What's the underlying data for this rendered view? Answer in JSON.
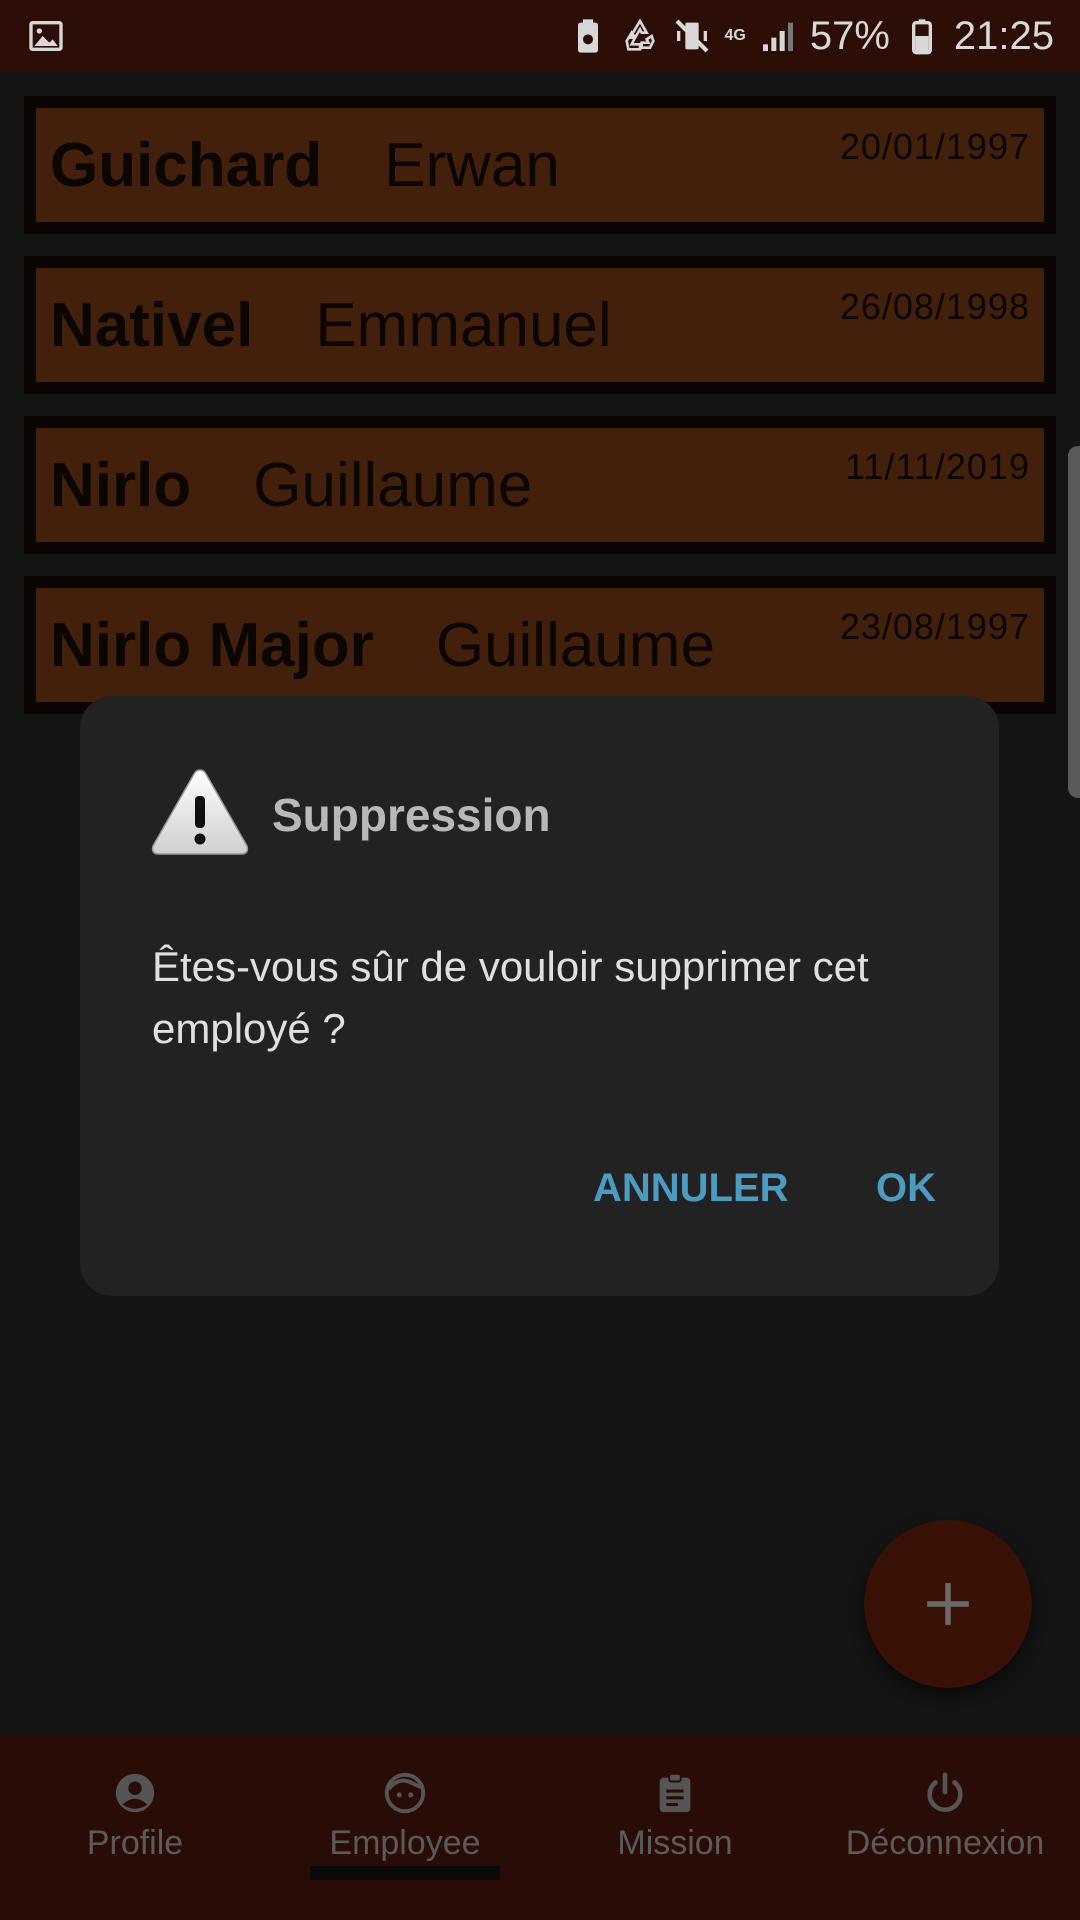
{
  "status_bar": {
    "network": "4G",
    "battery": "57%",
    "time": "21:25"
  },
  "employees": [
    {
      "last_name": "Guichard",
      "first_name": "Erwan",
      "date": "20/01/1997"
    },
    {
      "last_name": "Nativel",
      "first_name": "Emmanuel",
      "date": "26/08/1998"
    },
    {
      "last_name": "Nirlo",
      "first_name": "Guillaume",
      "date": "11/11/2019"
    },
    {
      "last_name": "Nirlo Major",
      "first_name": "Guillaume",
      "date": "23/08/1997"
    }
  ],
  "dialog": {
    "title": "Suppression",
    "message": "Êtes-vous sûr de vouloir supprimer cet employé ?",
    "cancel_label": "ANNULER",
    "ok_label": "OK",
    "icon": "warning-icon"
  },
  "fab": {
    "icon": "plus-icon"
  },
  "bottom_nav": [
    {
      "label": "Profile",
      "icon": "account-circle-icon"
    },
    {
      "label": "Employee",
      "icon": "face-icon"
    },
    {
      "label": "Mission",
      "icon": "clipboard-icon"
    },
    {
      "label": "Déconnexion",
      "icon": "power-icon"
    }
  ],
  "colors": {
    "app_bar": "#2d0e06",
    "card": "#42200b",
    "dialog_bg": "#222222",
    "accent_button": "#4c9bc0"
  }
}
